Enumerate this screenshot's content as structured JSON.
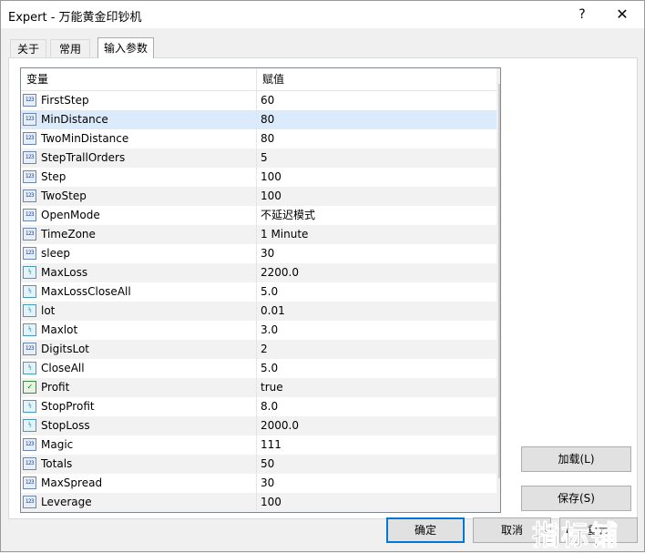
{
  "window": {
    "title": "Expert - 万能黄金印钞机",
    "help": "?",
    "close": "✕"
  },
  "tabs": [
    {
      "label": "关于"
    },
    {
      "label": "常用"
    },
    {
      "label": "输入参数"
    }
  ],
  "grid": {
    "headers": {
      "variable": "变量",
      "value": "赋值"
    },
    "rows": [
      {
        "name": "FirstStep",
        "value": "60",
        "type": "int"
      },
      {
        "name": "MinDistance",
        "value": "80",
        "type": "int"
      },
      {
        "name": "TwoMinDistance",
        "value": "80",
        "type": "int"
      },
      {
        "name": "StepTrallOrders",
        "value": "5",
        "type": "int"
      },
      {
        "name": "Step",
        "value": "100",
        "type": "int"
      },
      {
        "name": "TwoStep",
        "value": "100",
        "type": "int"
      },
      {
        "name": "OpenMode",
        "value": "不延迟模式",
        "type": "int"
      },
      {
        "name": "TimeZone",
        "value": "1 Minute",
        "type": "int"
      },
      {
        "name": "sleep",
        "value": "30",
        "type": "int"
      },
      {
        "name": "MaxLoss",
        "value": "2200.0",
        "type": "double"
      },
      {
        "name": "MaxLossCloseAll",
        "value": "5.0",
        "type": "double"
      },
      {
        "name": "lot",
        "value": "0.01",
        "type": "double"
      },
      {
        "name": "Maxlot",
        "value": "3.0",
        "type": "double"
      },
      {
        "name": "DigitsLot",
        "value": "2",
        "type": "int"
      },
      {
        "name": "CloseAll",
        "value": "5.0",
        "type": "double"
      },
      {
        "name": "Profit",
        "value": "true",
        "type": "bool"
      },
      {
        "name": "StopProfit",
        "value": "8.0",
        "type": "double"
      },
      {
        "name": "StopLoss",
        "value": "2000.0",
        "type": "double"
      },
      {
        "name": "Magic",
        "value": "111",
        "type": "int"
      },
      {
        "name": "Totals",
        "value": "50",
        "type": "int"
      },
      {
        "name": "MaxSpread",
        "value": "30",
        "type": "int"
      },
      {
        "name": "Leverage",
        "value": "100",
        "type": "int"
      }
    ],
    "selected_row": "MinDistance"
  },
  "icons": {
    "int": "123",
    "double": "½",
    "bool": "✓"
  },
  "buttons": {
    "load": "加载(L)",
    "save": "保存(S)",
    "ok": "确定",
    "cancel": "取消",
    "reset": "重置"
  },
  "watermark": "指标铺",
  "colors": {
    "selection": "#dcebfc",
    "default_button_border": "#0078d7"
  }
}
